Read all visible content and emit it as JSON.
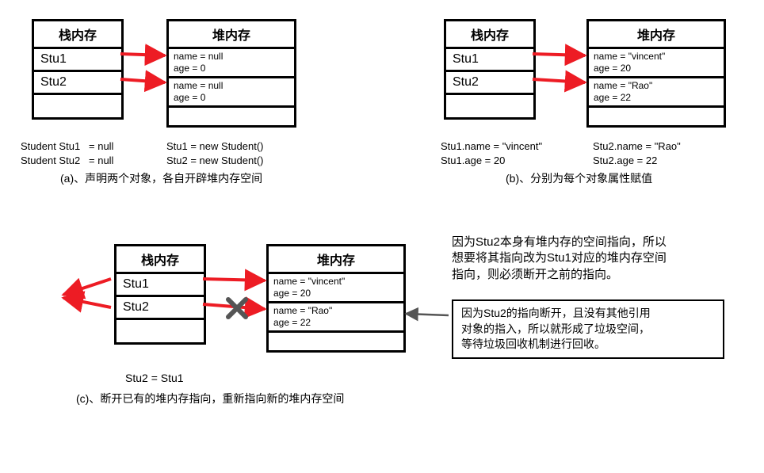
{
  "stack_label": "栈内存",
  "heap_label": "堆内存",
  "a": {
    "stack": [
      "Stu1",
      "Stu2"
    ],
    "heap": [
      {
        "l1": "name = null",
        "l2": "age = 0"
      },
      {
        "l1": "name = null",
        "l2": "age = 0"
      }
    ],
    "code_left": "Student Stu1   = null\nStudent Stu2   = null",
    "code_right": "Stu1 = new Student()\nStu2 = new Student()",
    "caption": "(a)、声明两个对象，各自开辟堆内存空间"
  },
  "b": {
    "stack": [
      "Stu1",
      "Stu2"
    ],
    "heap": [
      {
        "l1": "name = \"vincent\"",
        "l2": "age = 20"
      },
      {
        "l1": "name = \"Rao\"",
        "l2": "age = 22"
      }
    ],
    "code_left": "Stu1.name = \"vincent\"\nStu1.age = 20",
    "code_right": "Stu2.name = \"Rao\"\nStu2.age = 22",
    "caption": "(b)、分别为每个对象属性赋值"
  },
  "c": {
    "stack": [
      "Stu1",
      "Stu2"
    ],
    "heap": [
      {
        "l1": "name = \"vincent\"",
        "l2": "age = 20"
      },
      {
        "l1": "name = \"Rao\"",
        "l2": "age = 22"
      }
    ],
    "code": "Stu2 = Stu1",
    "caption": "(c)、断开已有的堆内存指向，重新指向新的堆内存空间",
    "note1": "因为Stu2本身有堆内存的空间指向，所以\n想要将其指向改为Stu1对应的堆内存空间\n指向，则必须断开之前的指向。",
    "note2": "因为Stu2的指向断开，且没有其他引用\n对象的指入，所以就形成了垃圾空间，\n等待垃圾回收机制进行回收。"
  }
}
